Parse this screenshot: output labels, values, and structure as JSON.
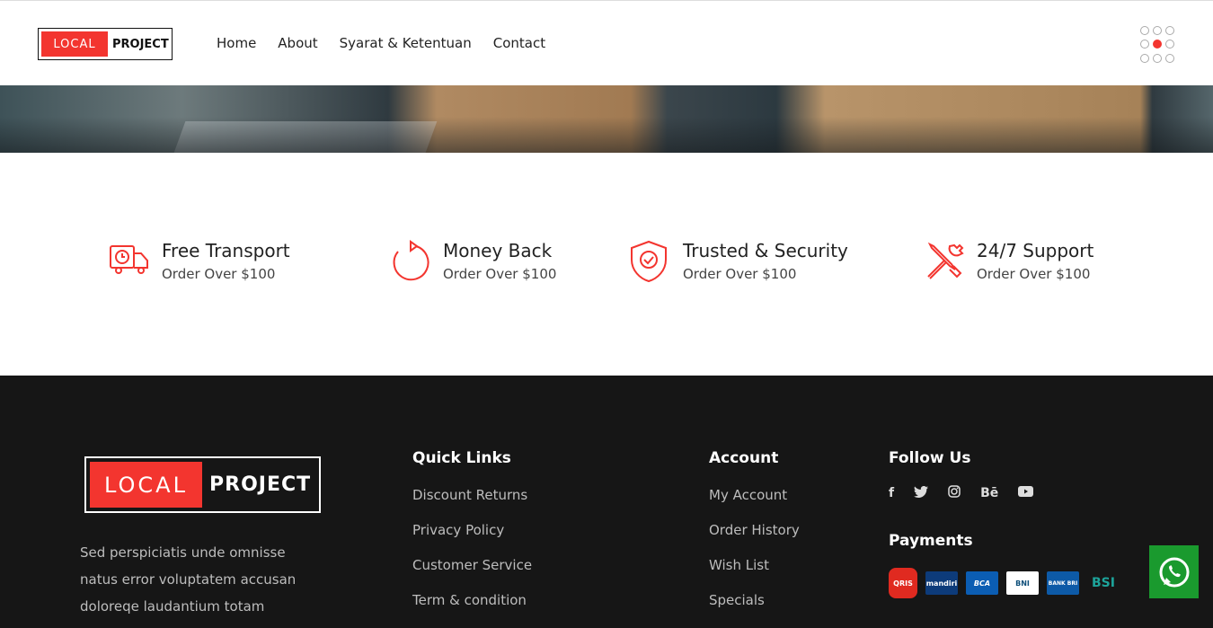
{
  "header": {
    "logo_left": "LOCAL",
    "logo_right": "PROJECT",
    "nav": [
      "Home",
      "About",
      "Syarat & Ketentuan",
      "Contact"
    ],
    "menu_icon": "dots-grid-icon"
  },
  "features": [
    {
      "title": "Free Transport",
      "subtitle": "Order Over $100",
      "icon": "truck-icon"
    },
    {
      "title": "Money Back",
      "subtitle": "Order Over $100",
      "icon": "refresh-icon"
    },
    {
      "title": "Trusted & Security",
      "subtitle": "Order Over $100",
      "icon": "shield-check-icon"
    },
    {
      "title": "24/7 Support",
      "subtitle": "Order Over $100",
      "icon": "tools-icon"
    }
  ],
  "footer": {
    "logo_left": "LOCAL",
    "logo_right": "PROJECT",
    "about": "Sed perspiciatis unde omnisse natus error voluptatem accusan doloreqe laudantium totam",
    "quick_links": {
      "title": "Quick Links",
      "items": [
        "Discount Returns",
        "Privacy Policy",
        "Customer Service",
        "Term & condition"
      ]
    },
    "account": {
      "title": "Account",
      "items": [
        "My Account",
        "Order History",
        "Wish List",
        "Specials"
      ]
    },
    "follow": {
      "title": "Follow Us",
      "icons": [
        "facebook-icon",
        "twitter-icon",
        "instagram-icon",
        "behance-icon",
        "youtube-icon"
      ],
      "glyphs": [
        "f",
        "🐦",
        "◎",
        "Bē",
        "▶"
      ]
    },
    "payments": {
      "title": "Payments",
      "items": [
        "QRIS",
        "mandiri",
        "BCA",
        "BNI",
        "BANK BRI",
        "BSI"
      ]
    }
  },
  "colors": {
    "accent": "#f3352f",
    "footer_bg": "#161616",
    "whatsapp": "#1a9a2e"
  }
}
